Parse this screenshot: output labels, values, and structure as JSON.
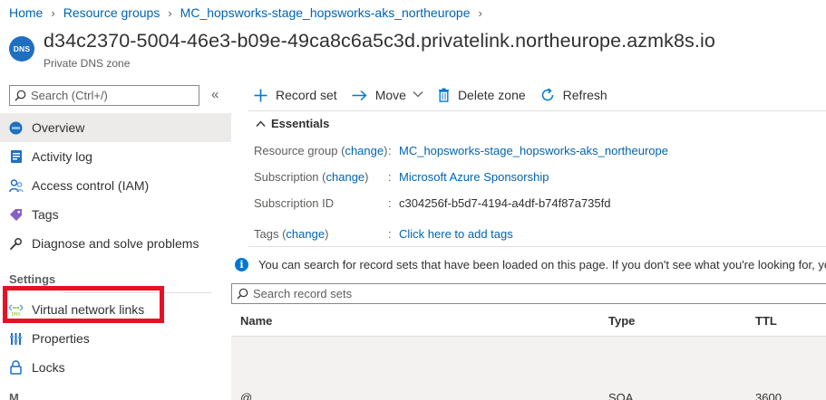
{
  "breadcrumb": [
    "Home",
    "Resource groups",
    "MC_hopsworks-stage_hopsworks-aks_northeurope"
  ],
  "header": {
    "icon_text": "DNS",
    "title": "d34c2370-5004-46e3-b09e-49ca8c6a5c3d.privatelink.northeurope.azmk8s.io",
    "subtitle": "Private DNS zone",
    "extra": "⁠×"
  },
  "sidebar": {
    "search_placeholder": "Search (Ctrl+/)",
    "collapse_glyph": "«",
    "items": [
      {
        "label": "Overview",
        "icon": "dns-overview-icon"
      },
      {
        "label": "Activity log",
        "icon": "activity-log-icon"
      },
      {
        "label": "Access control (IAM)",
        "icon": "iam-people-icon"
      },
      {
        "label": "Tags",
        "icon": "tag-icon"
      },
      {
        "label": "Diagnose and solve problems",
        "icon": "wrench-icon"
      }
    ],
    "settings_label": "Settings",
    "settings_items": [
      {
        "label": "Virtual network links",
        "icon": "vnet-link-icon"
      },
      {
        "label": "Properties",
        "icon": "properties-icon"
      },
      {
        "label": "Locks",
        "icon": "lock-icon"
      }
    ],
    "next_section_partial": "M"
  },
  "toolbar": {
    "record_set": "Record set",
    "move": "Move",
    "delete_zone": "Delete zone",
    "refresh": "Refresh"
  },
  "essentials": {
    "title": "Essentials",
    "rows": [
      {
        "label": "Resource group",
        "change": "change",
        "value": "MC_hopsworks-stage_hopsworks-aks_northeurope",
        "link": true
      },
      {
        "label": "Subscription",
        "change": "change",
        "value": "Microsoft Azure Sponsorship",
        "link": true
      },
      {
        "label": "Subscription ID",
        "change": "",
        "value": "c304256f-b5d7-4194-a4df-b74f87a735fd",
        "link": false
      },
      {
        "label": "Tags",
        "change": "change",
        "value": "Click here to add tags",
        "link": true
      }
    ]
  },
  "info": {
    "text": "You can search for record sets that have been loaded on this page. If you don't see what you're looking for, yo"
  },
  "records": {
    "search_placeholder": "Search record sets",
    "columns": [
      "Name",
      "Type",
      "TTL"
    ],
    "rows": [
      {
        "name": "@",
        "type": "SOA",
        "ttl": "3600"
      }
    ]
  },
  "colors": {
    "accent": "#0078d4",
    "link": "#0063b1",
    "highlight": "#e81123"
  }
}
